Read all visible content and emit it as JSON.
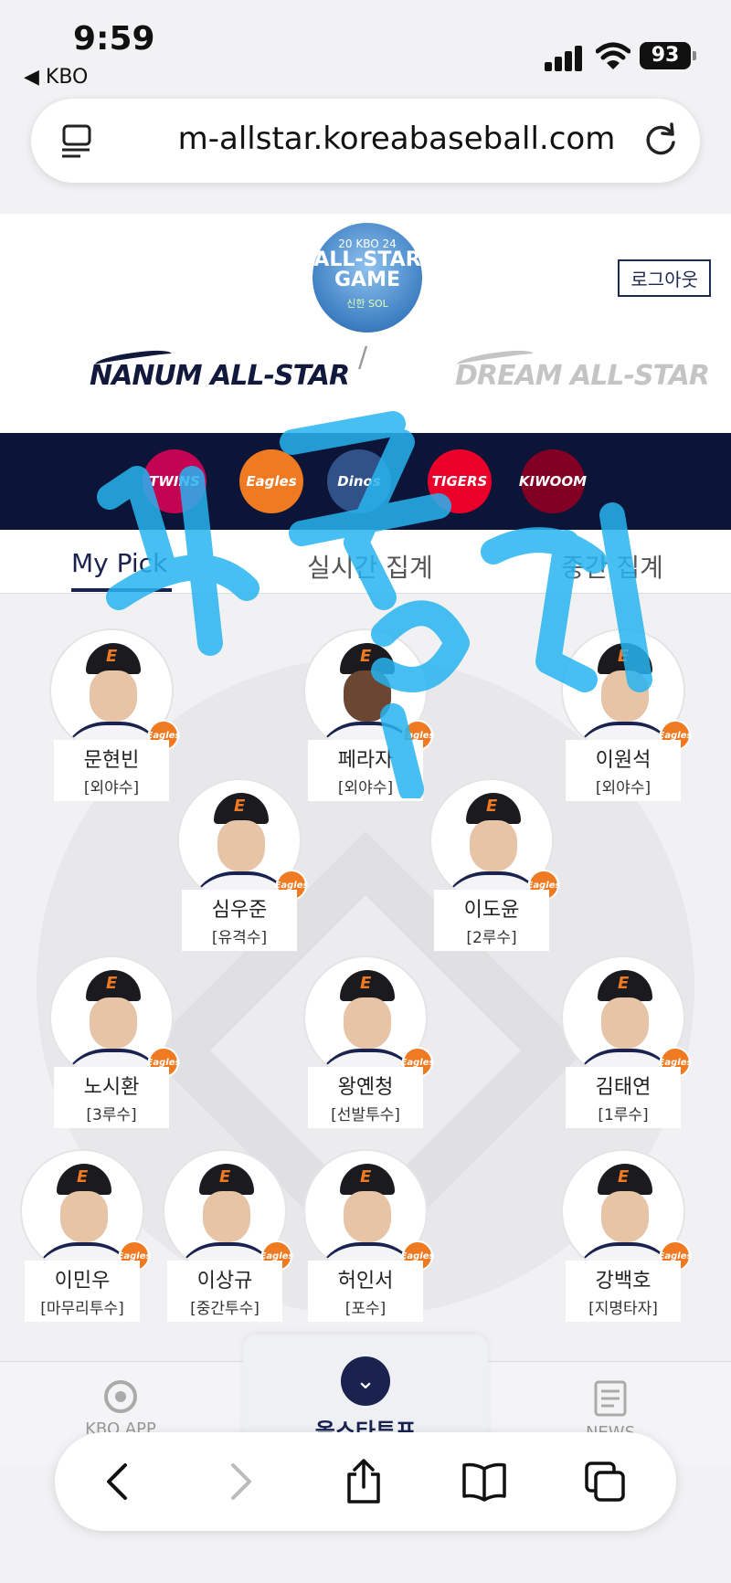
{
  "status_bar": {
    "time": "9:59",
    "back_app": "◀ KBO",
    "battery": "93"
  },
  "browser": {
    "url": "m-allstar.koreabaseball.com"
  },
  "header": {
    "logo_top": "20 KBO 24",
    "logo_main": "ALL-STAR GAME",
    "logo_sponsor": "신한 SOL",
    "logout_label": "로그아웃",
    "team_left": "NANUM ALL-STAR",
    "team_right": "DREAM ALL-STAR",
    "vs_divider": "/"
  },
  "teams": [
    {
      "name": "TWINS",
      "color": "#c30452"
    },
    {
      "name": "Eagles",
      "color": "#f07a22"
    },
    {
      "name": "Dinos",
      "color": "#315288"
    },
    {
      "name": "TIGERS",
      "color": "#ea0029"
    },
    {
      "name": "KIWOOM",
      "color": "#820024"
    }
  ],
  "tabs": [
    {
      "label": "My Pick"
    },
    {
      "label": "실시간 집계"
    },
    {
      "label": "중간 집계"
    }
  ],
  "players": [
    {
      "name": "문현빈",
      "position": "[외야수]"
    },
    {
      "name": "페라자",
      "position": "[외야수]"
    },
    {
      "name": "이원석",
      "position": "[외야수]"
    },
    {
      "name": "심우준",
      "position": "[유격수]"
    },
    {
      "name": "이도윤",
      "position": "[2루수]"
    },
    {
      "name": "노시환",
      "position": "[3루수]"
    },
    {
      "name": "왕옌청",
      "position": "[선발투수]"
    },
    {
      "name": "김태연",
      "position": "[1루수]"
    },
    {
      "name": "이민우",
      "position": "[마무리투수]"
    },
    {
      "name": "이상규",
      "position": "[중간투수]"
    },
    {
      "name": "허인서",
      "position": "[포수]"
    },
    {
      "name": "강백호",
      "position": "[지명타자]"
    }
  ],
  "team_mark": "Eagles",
  "bottom_nav": {
    "left": "KBO APP",
    "center": "올스타투표",
    "right": "NEWS"
  },
  "colors": {
    "navy": "#1a2350",
    "strip": "#0c1438",
    "eagles_orange": "#f07a22",
    "doodle": "#28b4f0"
  }
}
